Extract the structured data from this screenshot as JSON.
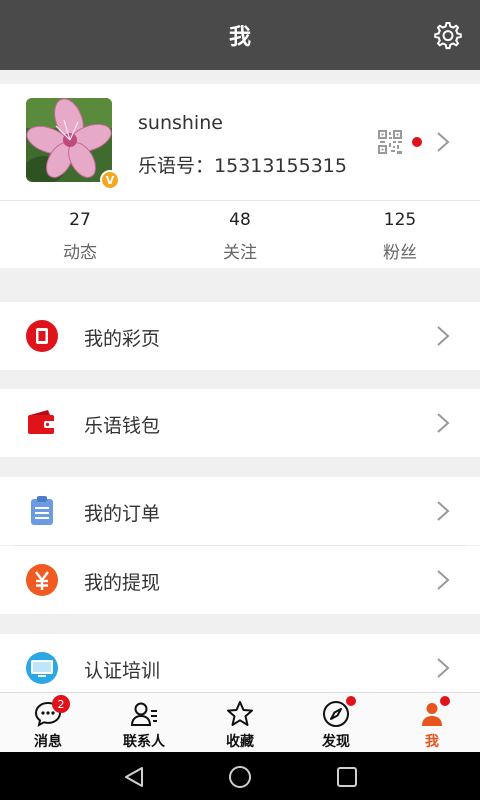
{
  "header": {
    "title": "我"
  },
  "profile": {
    "username": "sunshine",
    "id_label": "乐语号：",
    "id_value": "15313155315",
    "badge": "V"
  },
  "stats": [
    {
      "value": "27",
      "label": "动态"
    },
    {
      "value": "48",
      "label": "关注"
    },
    {
      "value": "125",
      "label": "粉丝"
    }
  ],
  "menu": {
    "caiye": "我的彩页",
    "wallet": "乐语钱包",
    "orders": "我的订单",
    "withdraw": "我的提现",
    "training": "认证培训"
  },
  "tabs": [
    {
      "label": "消息",
      "badge": "2"
    },
    {
      "label": "联系人"
    },
    {
      "label": "收藏"
    },
    {
      "label": "发现"
    },
    {
      "label": "我"
    }
  ],
  "colors": {
    "topbar": "#4a4a4a",
    "accent_red": "#e0121a",
    "active_tab": "#e8541e",
    "badge_gold": "#f5a623"
  }
}
